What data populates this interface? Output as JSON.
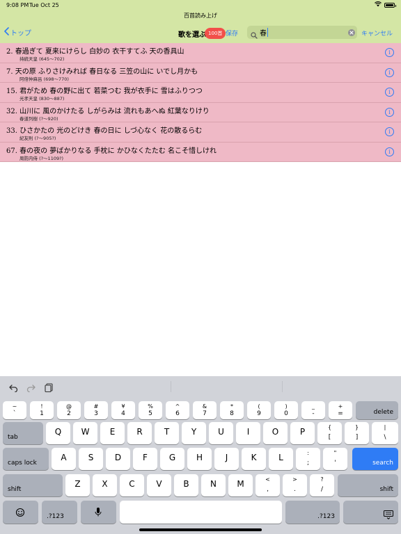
{
  "status": {
    "time": "9:08 PM",
    "date": "Tue Oct 25",
    "battery_percent": 100
  },
  "app_title": "百首読み上げ",
  "nav": {
    "back_label": "トップ",
    "title": "歌を選ぶ",
    "count_badge": "100首",
    "save_label": "保存",
    "cancel_label": "キャンセル"
  },
  "search": {
    "value": "春",
    "placeholder": ""
  },
  "results": [
    {
      "poem": "2. 春過ぎて 夏来にけらし 白妙の 衣干すてふ 天の香具山",
      "author": "持統天皇 (645～702)"
    },
    {
      "poem": "7. 天の原 ふりさけみれば 春日なる 三笠の山に いでし月かも",
      "author": "阿倍仲麻呂 (698～770)"
    },
    {
      "poem": "15. 君がため 春の野に出て 若菜つむ 我が衣手に 雪はふりつつ",
      "author": "光孝天皇 (830～887)"
    },
    {
      "poem": "32. 山川に 風のかけたる しがらみは 流れもあへぬ 紅葉なりけり",
      "author": "春道列樹 (?～920)"
    },
    {
      "poem": "33. ひさかたの 光のどけき 春の日に しづ心なく 花の散るらむ",
      "author": "紀友則 (?～905?)"
    },
    {
      "poem": "67. 春の夜の 夢ばかりなる 手枕に かひなくたたむ 名こそ惜しけれ",
      "author": "周防内侍 (?～1109?)"
    }
  ],
  "info_glyph": "i",
  "keyboard": {
    "toolbar_icons": [
      "undo-icon",
      "redo-icon",
      "clipboard-icon"
    ],
    "row1": [
      {
        "top": "~",
        "bottom": "`"
      },
      {
        "top": "!",
        "bottom": "1"
      },
      {
        "top": "@",
        "bottom": "2"
      },
      {
        "top": "#",
        "bottom": "3"
      },
      {
        "top": "¥",
        "bottom": "4"
      },
      {
        "top": "%",
        "bottom": "5"
      },
      {
        "top": "^",
        "bottom": "6"
      },
      {
        "top": "&",
        "bottom": "7"
      },
      {
        "top": "*",
        "bottom": "8"
      },
      {
        "top": "(",
        "bottom": "9"
      },
      {
        "top": ")",
        "bottom": "0"
      },
      {
        "top": "_",
        "bottom": "-"
      },
      {
        "top": "+",
        "bottom": "="
      }
    ],
    "delete_label": "delete",
    "tab_label": "tab",
    "row2": [
      "Q",
      "W",
      "E",
      "R",
      "T",
      "Y",
      "U",
      "I",
      "O",
      "P"
    ],
    "row2_pairs": [
      {
        "top": "{",
        "bottom": "["
      },
      {
        "top": "}",
        "bottom": "]"
      },
      {
        "top": "|",
        "bottom": "\\"
      }
    ],
    "caps_label": "caps lock",
    "row3": [
      "A",
      "S",
      "D",
      "F",
      "G",
      "H",
      "J",
      "K",
      "L"
    ],
    "row3_pairs": [
      {
        "top": ":",
        "bottom": ";"
      },
      {
        "top": "\"",
        "bottom": "'"
      }
    ],
    "search_label": "search",
    "shift_label": "shift",
    "row4": [
      "Z",
      "X",
      "C",
      "V",
      "B",
      "N",
      "M"
    ],
    "row4_pairs": [
      {
        "top": "<",
        "bottom": ","
      },
      {
        "top": ">",
        "bottom": "."
      },
      {
        "top": "?",
        "bottom": "/"
      }
    ],
    "numbers_label": ".?123",
    "emoji_icon": "emoji-icon",
    "mic_icon": "microphone-icon",
    "hide_icon": "keyboard-hide-icon"
  },
  "colors": {
    "header_bg": "#d4e6a5",
    "row_bg": "#efb9c6",
    "accent": "#2f7cf5",
    "badge": "#f24f4a",
    "keyboard_bg": "#d1d3d9"
  }
}
